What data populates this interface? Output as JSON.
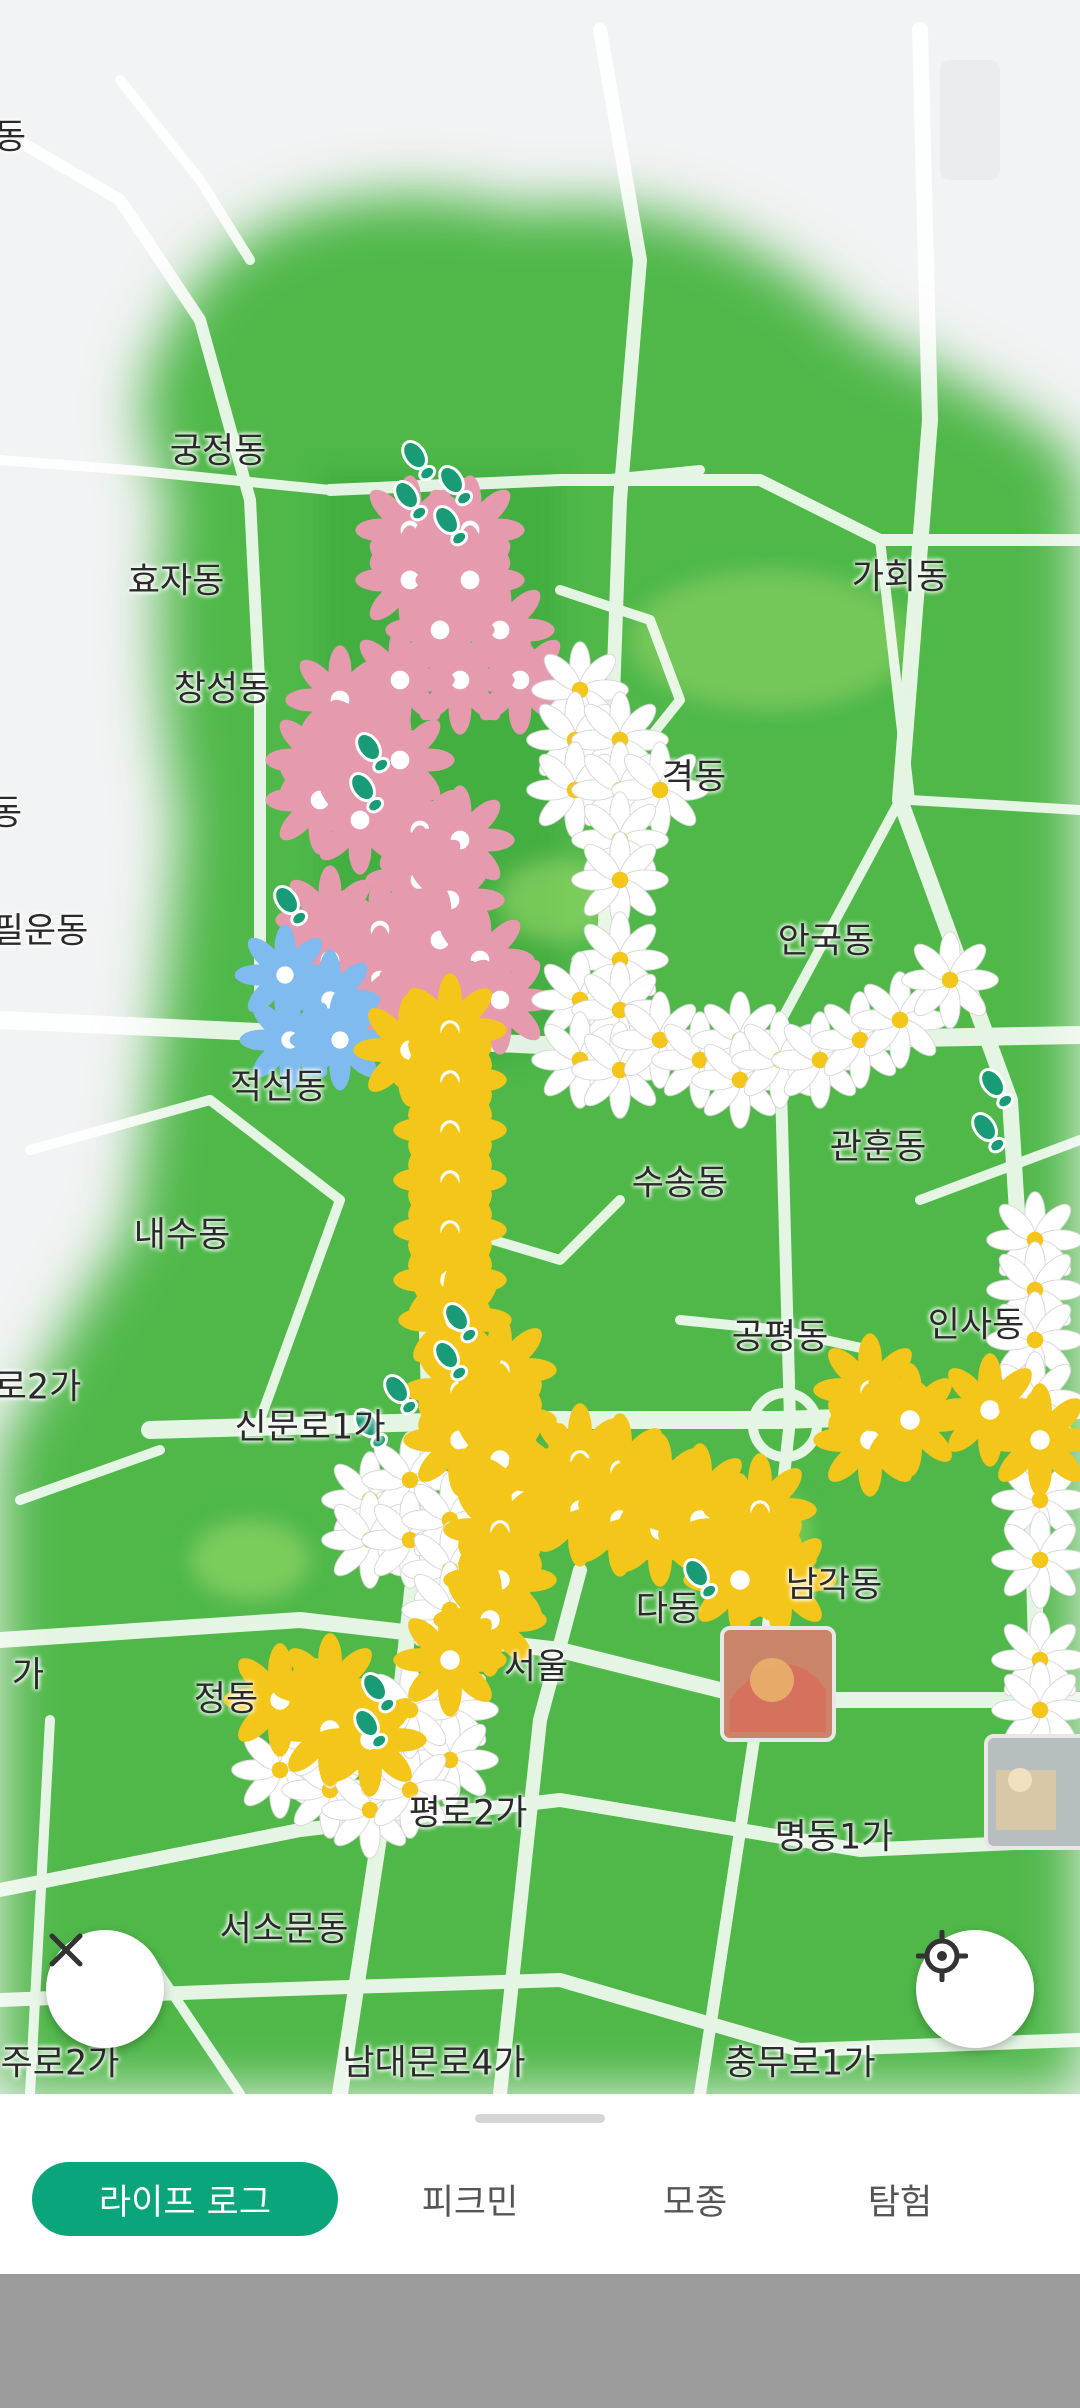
{
  "map": {
    "labels": [
      {
        "key": "gungjeong",
        "text": "궁정동"
      },
      {
        "key": "hyoja",
        "text": "효자동"
      },
      {
        "key": "changseong",
        "text": "창성동"
      },
      {
        "key": "pilun",
        "text": "필운동"
      },
      {
        "key": "jeokseon",
        "text": "적선동"
      },
      {
        "key": "naesu",
        "text": "내수동"
      },
      {
        "key": "sinmunno",
        "text": "신문로1가"
      },
      {
        "key": "ro2ga_left",
        "text": "로2가"
      },
      {
        "key": "ga_left",
        "text": "가"
      },
      {
        "key": "jeong",
        "text": "정동"
      },
      {
        "key": "taepyeongno",
        "text": "평로2가"
      },
      {
        "key": "seosomun",
        "text": "서소문동"
      },
      {
        "key": "uijuro",
        "text": "주로2가"
      },
      {
        "key": "namdaemun",
        "text": "남대문로4가"
      },
      {
        "key": "gahoe",
        "text": "가회동"
      },
      {
        "key": "sogyeok",
        "text": "격동"
      },
      {
        "key": "anguk",
        "text": "안국동"
      },
      {
        "key": "gwanhun",
        "text": "관훈동"
      },
      {
        "key": "susong",
        "text": "수송동"
      },
      {
        "key": "insa",
        "text": "인사동"
      },
      {
        "key": "gongpyeong",
        "text": "공평동"
      },
      {
        "key": "dadong",
        "text": "다동"
      },
      {
        "key": "namgak",
        "text": "남각동"
      },
      {
        "key": "seoul",
        "text": "서울"
      },
      {
        "key": "myeongdong",
        "text": "명동1가"
      },
      {
        "key": "chungmuro",
        "text": "충무로1가"
      },
      {
        "key": "dong_edge",
        "text": "동"
      },
      {
        "key": "dong_edge2",
        "text": "동"
      }
    ],
    "accent_colors": {
      "grass": "#4fb848",
      "pink_flower": "#e59aae",
      "white_flower": "#ffffff",
      "yellow_flower": "#f5c61a",
      "blue_flower": "#7fbbee",
      "footprint": "#1a9b78"
    },
    "close_icon": "close-icon",
    "locate_icon": "crosshair-icon"
  },
  "tabs": [
    {
      "label": "라이프 로그",
      "active": true
    },
    {
      "label": "피크민",
      "active": false
    },
    {
      "label": "모종",
      "active": false
    },
    {
      "label": "탐험",
      "active": false
    }
  ]
}
